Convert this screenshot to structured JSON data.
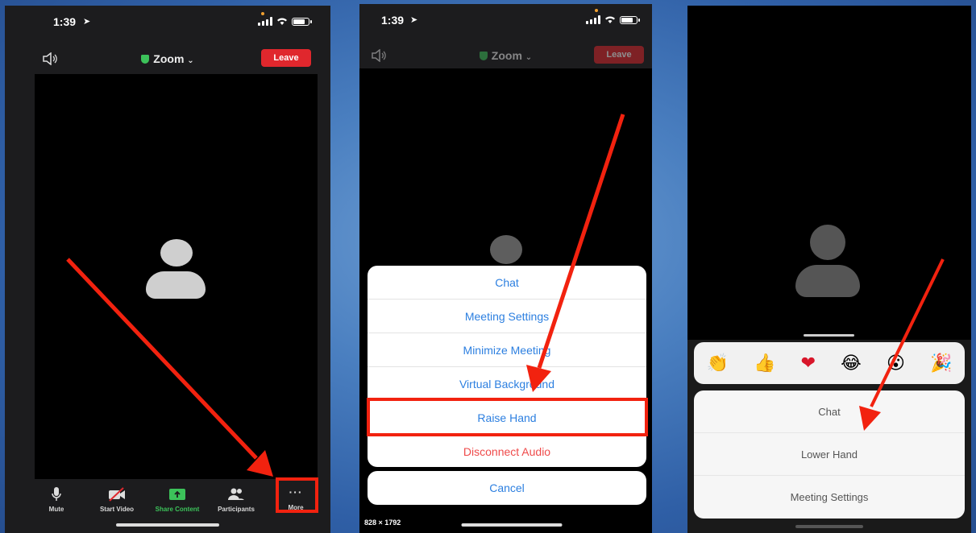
{
  "status_bar": {
    "time": "1:39"
  },
  "header": {
    "title": "Zoom",
    "leave_label": "Leave"
  },
  "toolbar": {
    "mute": "Mute",
    "start_video": "Start Video",
    "share_content": "Share Content",
    "participants": "Participants",
    "more": "More"
  },
  "more_menu": {
    "items": [
      "Chat",
      "Meeting Settings",
      "Minimize Meeting",
      "Virtual Background",
      "Raise Hand",
      "Disconnect Audio"
    ],
    "cancel": "Cancel",
    "dimensions_label": "828 × 1792"
  },
  "reaction_menu": {
    "reactions": [
      "clap",
      "thumbs-up",
      "heart",
      "tears-of-joy",
      "open-mouth",
      "party-popper"
    ],
    "items": [
      "Chat",
      "Lower Hand",
      "Meeting Settings"
    ]
  },
  "colors": {
    "leave": "#e0272d",
    "highlight": "#f2220f",
    "link": "#2c7fe0",
    "danger": "#ef4a4a",
    "share": "#3cc25a"
  }
}
